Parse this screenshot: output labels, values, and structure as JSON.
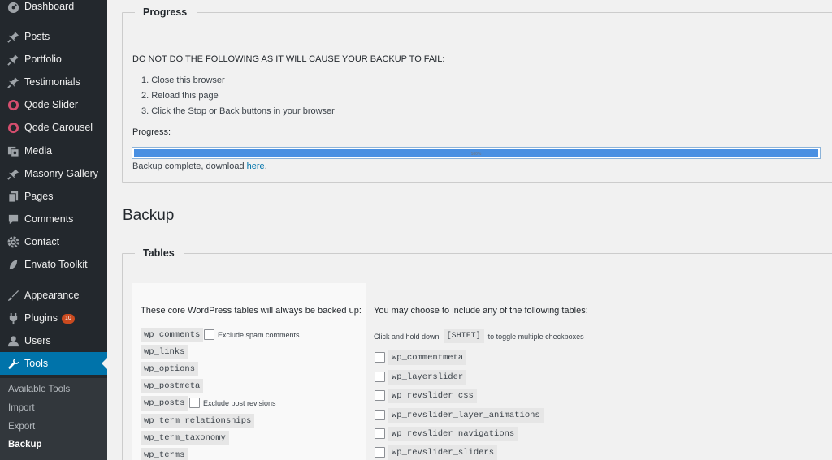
{
  "sidebar": {
    "items": [
      {
        "label": "Dashboard",
        "icon": "dashboard-icon"
      },
      {
        "label": "Posts",
        "icon": "pin-icon"
      },
      {
        "label": "Portfolio",
        "icon": "pin-icon"
      },
      {
        "label": "Testimonials",
        "icon": "pin-icon"
      },
      {
        "label": "Qode Slider",
        "icon": "ring-icon"
      },
      {
        "label": "Qode Carousel",
        "icon": "ring-icon"
      },
      {
        "label": "Media",
        "icon": "media-icon"
      },
      {
        "label": "Masonry Gallery",
        "icon": "pin-icon"
      },
      {
        "label": "Pages",
        "icon": "pages-icon"
      },
      {
        "label": "Comments",
        "icon": "comment-icon"
      },
      {
        "label": "Contact",
        "icon": "gear-icon"
      },
      {
        "label": "Envato Toolkit",
        "icon": "leaf-icon"
      },
      {
        "label": "Appearance",
        "icon": "brush-icon"
      },
      {
        "label": "Plugins",
        "icon": "plug-icon",
        "badge": "10"
      },
      {
        "label": "Users",
        "icon": "user-icon"
      },
      {
        "label": "Tools",
        "icon": "wrench-icon"
      }
    ],
    "submenu": [
      "Available Tools",
      "Import",
      "Export",
      "Backup"
    ]
  },
  "progress": {
    "legend": "Progress",
    "warning": "DO NOT DO THE FOLLOWING AS IT WILL CAUSE YOUR BACKUP TO FAIL:",
    "steps": [
      "1. Close this browser",
      "2. Reload this page",
      "3. Click the Stop or Back buttons in your browser"
    ],
    "label": "Progress:",
    "percent_text": "100%",
    "value": 1.0,
    "complete_text": "Backup complete, download ",
    "link_text": "here",
    "period": "."
  },
  "page_title": "Backup",
  "tables": {
    "legend": "Tables",
    "core_heading": "These core WordPress tables will always be backed up:",
    "core_tables": [
      "wp_comments",
      "wp_links",
      "wp_options",
      "wp_postmeta",
      "wp_posts",
      "wp_term_relationships",
      "wp_term_taxonomy",
      "wp_terms"
    ],
    "exclude_spam": "Exclude spam comments",
    "exclude_revisions": "Exclude post revisions",
    "optional_heading": "You may choose to include any of the following tables:",
    "hint_before": "Click and hold down",
    "hint_key": "[SHIFT]",
    "hint_after": "to toggle multiple checkboxes",
    "optional_tables": [
      "wp_commentmeta",
      "wp_layerslider",
      "wp_revslider_css",
      "wp_revslider_layer_animations",
      "wp_revslider_navigations",
      "wp_revslider_sliders"
    ]
  },
  "colors": {
    "sidebar_bg": "#23282d",
    "accent": "#0073aa",
    "progress_fill": "#4a90e2"
  }
}
